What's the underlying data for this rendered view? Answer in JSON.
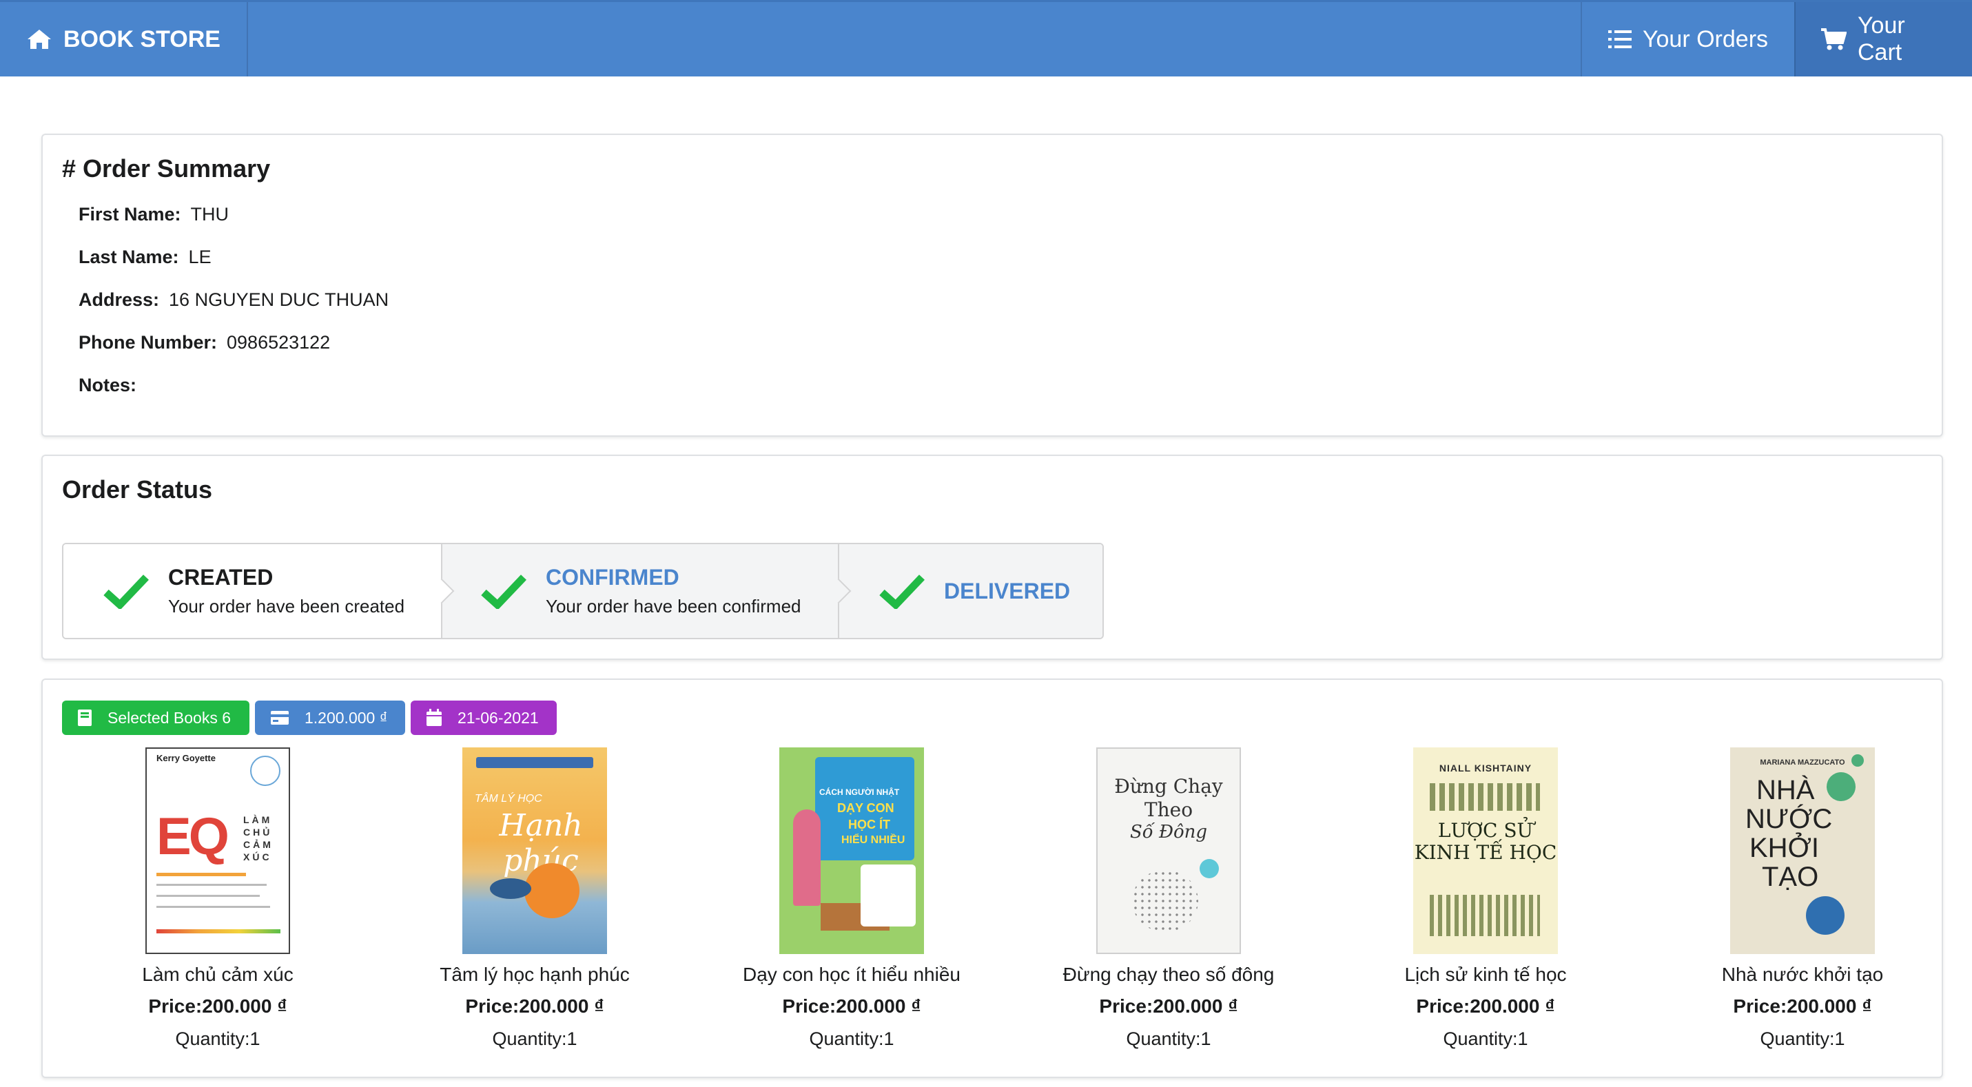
{
  "nav": {
    "brand": "BOOK STORE",
    "orders": "Your Orders",
    "cart": "Your Cart"
  },
  "summary": {
    "title": "# Order Summary",
    "fields": [
      {
        "label": "First Name:",
        "value": "THU"
      },
      {
        "label": "Last Name:",
        "value": "LE"
      },
      {
        "label": "Address:",
        "value": "16 NGUYEN DUC THUAN"
      },
      {
        "label": "Phone Number:",
        "value": "0986523122"
      },
      {
        "label": "Notes:",
        "value": ""
      }
    ]
  },
  "status": {
    "title": "Order Status",
    "steps": [
      {
        "title": "CREATED",
        "desc": "Your order have been created"
      },
      {
        "title": "CONFIRMED",
        "desc": "Your order have been confirmed"
      },
      {
        "title": "DELIVERED",
        "desc": ""
      }
    ]
  },
  "labels": {
    "selected": "Selected Books 6",
    "total": "1.200.000 ₫",
    "date": "21-06-2021"
  },
  "books": [
    {
      "title": "Làm chủ cảm xúc",
      "price": "Price:200.000 ₫",
      "quantity": "Quantity:1",
      "cover_text": [
        "Kerry Goyette",
        "EQ",
        "LÀM CHỦ CẢM XÚC"
      ]
    },
    {
      "title": "Tâm lý học hạnh phúc",
      "price": "Price:200.000 ₫",
      "quantity": "Quantity:1",
      "cover_text": [
        "TÂM LÝ HỌC",
        "Hạnh phúc"
      ]
    },
    {
      "title": "Dạy con học ít hiểu nhiều",
      "price": "Price:200.000 ₫",
      "quantity": "Quantity:1",
      "cover_text": [
        "CÁCH NGƯỜI NHẬT",
        "DẠY CON",
        "HỌC ÍT",
        "HIỂU NHIỀU"
      ]
    },
    {
      "title": "Đừng chạy theo số đông",
      "price": "Price:200.000 ₫",
      "quantity": "Quantity:1",
      "cover_text": [
        "Đừng Chạy",
        "Theo",
        "Số Đông"
      ]
    },
    {
      "title": "Lịch sử kinh tế học",
      "price": "Price:200.000 ₫",
      "quantity": "Quantity:1",
      "cover_text": [
        "NIALL KISHTAINY",
        "LƯỢC SỬ",
        "KINH TẾ HỌC"
      ]
    },
    {
      "title": "Nhà nước khởi tạo",
      "price": "Price:200.000 ₫",
      "quantity": "Quantity:1",
      "cover_text": [
        "MARIANA MAZZUCATO",
        "NHÀ",
        "NƯỚC",
        "KHỞI",
        "TẠO"
      ]
    }
  ],
  "colors": {
    "primary": "#4a85cd",
    "success": "#21ba45",
    "purple": "#a333c8"
  }
}
